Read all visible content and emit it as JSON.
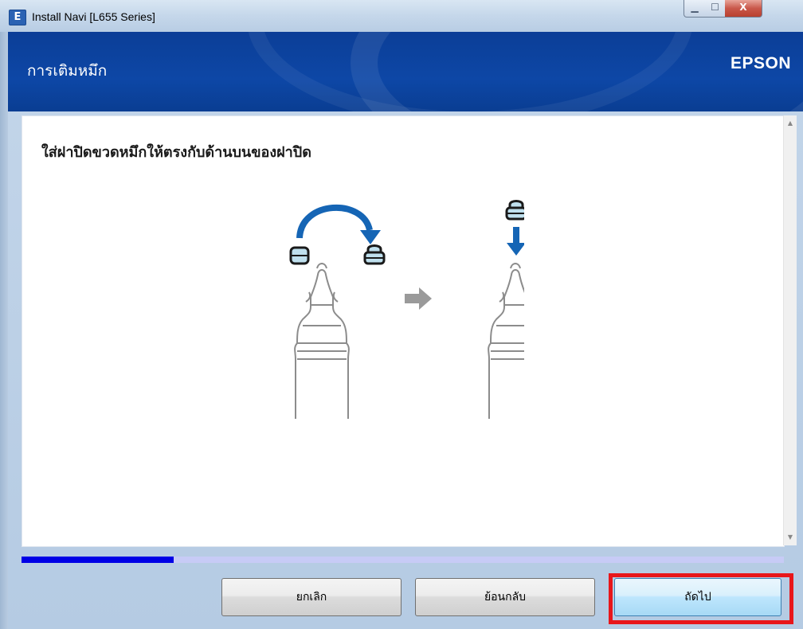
{
  "window": {
    "title": "Install Navi [L655 Series]",
    "app_icon_glyph": "E",
    "controls": {
      "minimize": "▁",
      "maximize": "☐",
      "close": "X"
    }
  },
  "header": {
    "title": "การเติมหมึก",
    "brand": "EPSON"
  },
  "content": {
    "instruction": "ใส่ฝาปิดขวดหมึกให้ตรงกับด้านบนของฝาปิด",
    "illustration_icons": [
      "curved-arrow-icon",
      "cap-icon",
      "arrow-right-icon",
      "arrow-down-icon",
      "bottle-icon"
    ]
  },
  "progress": {
    "fraction": 0.2
  },
  "buttons": {
    "cancel": "ยกเลิก",
    "back": "ย้อนกลับ",
    "next": "ถัดไป"
  },
  "colors": {
    "header_bg": "#0d47a6",
    "arrow_blue": "#1565b5",
    "progress_fill": "#0000e6",
    "progress_track": "#c7cbf6",
    "highlight": "#e8161a"
  }
}
